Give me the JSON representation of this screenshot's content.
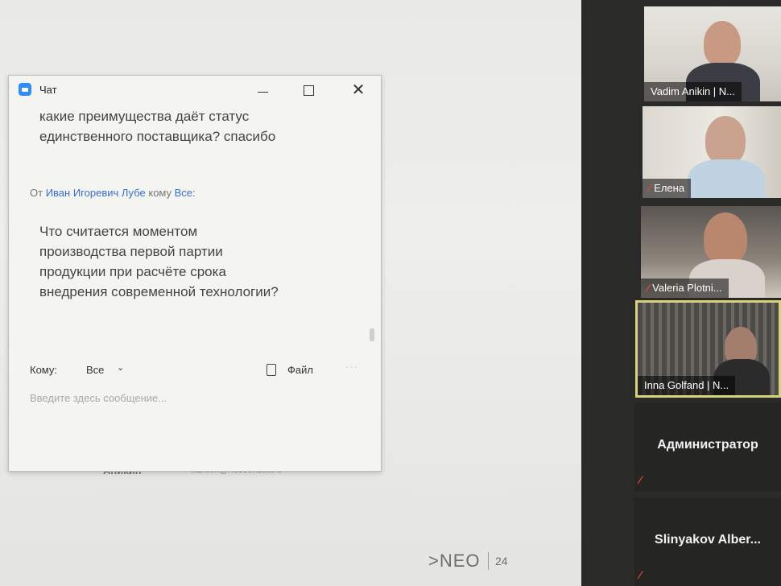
{
  "chat": {
    "title": "Чат",
    "window_buttons": {
      "close": "✕"
    },
    "messages": [
      {
        "text": "какие преимущества даёт статус единственного поставщика? спасибо"
      },
      {
        "meta_from": "От",
        "meta_sender": "Иван Игоревич Лубе",
        "meta_to": "кому",
        "meta_recipient": "Все:",
        "text": "Что считается моментом производства первой партии продукции при расчёте срока внедрения современной технологии?"
      }
    ],
    "to_label": "Кому:",
    "to_value": "Все",
    "file_label": "Файл",
    "more": "···",
    "input_placeholder": "Введите здесь сообщение..."
  },
  "slide": {
    "footer_name": "Аникин",
    "footer_email": "v.anikin@neoconsult.ru",
    "logo": ">NEO",
    "page": "24"
  },
  "participants": [
    {
      "name": "Vadim Anikin | N...",
      "muted": false
    },
    {
      "name": "Елена",
      "muted": true
    },
    {
      "name": "Valeria Plotni...",
      "muted": true
    },
    {
      "name": "Inna Golfand | N...",
      "muted": false,
      "active": true
    },
    {
      "name": "Администратор",
      "muted": true,
      "video": false
    },
    {
      "name": "Slinyakov Alber...",
      "muted": true,
      "video": false
    }
  ],
  "icons": {
    "muted": "mic-muted-icon",
    "chat_app": "zoom-icon",
    "file": "file-icon",
    "dropdown": "chevron-down-icon"
  },
  "colors": {
    "link": "#3a6fd1",
    "muted": "#e0463b",
    "active_border": "#d9d27a",
    "zoom_blue": "#2d8cff"
  }
}
